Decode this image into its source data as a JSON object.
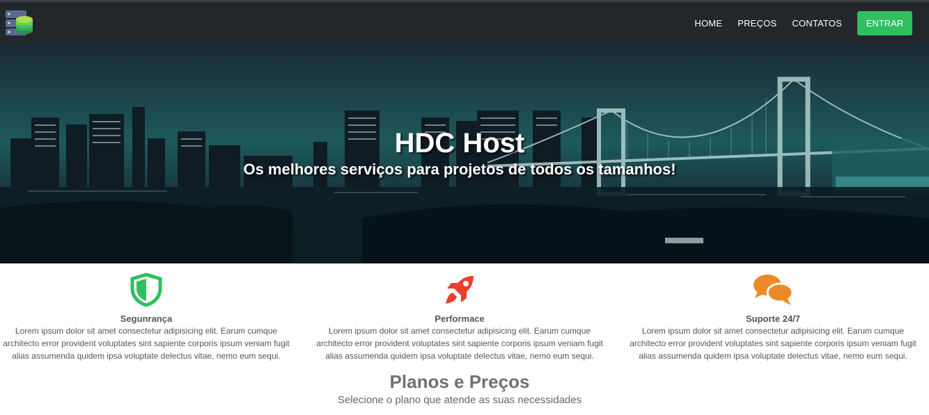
{
  "nav": {
    "links": [
      "HOME",
      "PREÇOS",
      "CONTATOS"
    ],
    "cta_label": "ENTRAR"
  },
  "hero": {
    "title": "HDC Host",
    "subtitle": "Os melhores serviços para projetos de todos os tamanhos!"
  },
  "features": [
    {
      "icon": "shield-icon",
      "color": "#2ebf5f",
      "title": "Segunrança",
      "text": "Lorem ipsum dolor sit amet consectetur adipisicing elit. Earum cumque architecto error provident voluptates sint sapiente corporis ipsum veniam fugit alias assumenda quidem ipsa voluptate delectus vitae, nemo eum sequi."
    },
    {
      "icon": "rocket-icon",
      "color": "#e8402b",
      "title": "Performace",
      "text": "Lorem ipsum dolor sit amet consectetur adipisicing elit. Earum cumque architecto error provident voluptates sint sapiente corporis ipsum veniam fugit alias assumenda quidem ipsa voluptate delectus vitae, nemo eum sequi."
    },
    {
      "icon": "chat-bubbles-icon",
      "color": "#ec8a27",
      "title": "Suporte 24/7",
      "text": "Lorem ipsum dolor sit amet consectetur adipisicing elit. Earum cumque architecto error provident voluptates sint sapiente corporis ipsum veniam fugit alias assumenda quidem ipsa voluptate delectus vitae, nemo eum sequi."
    }
  ],
  "plans": {
    "title": "Planos e Preços",
    "subtitle": "Selecione o plano que atende as suas necessidades"
  },
  "colors": {
    "navbar": "#23272c",
    "accent_green": "#2ebf5f"
  }
}
